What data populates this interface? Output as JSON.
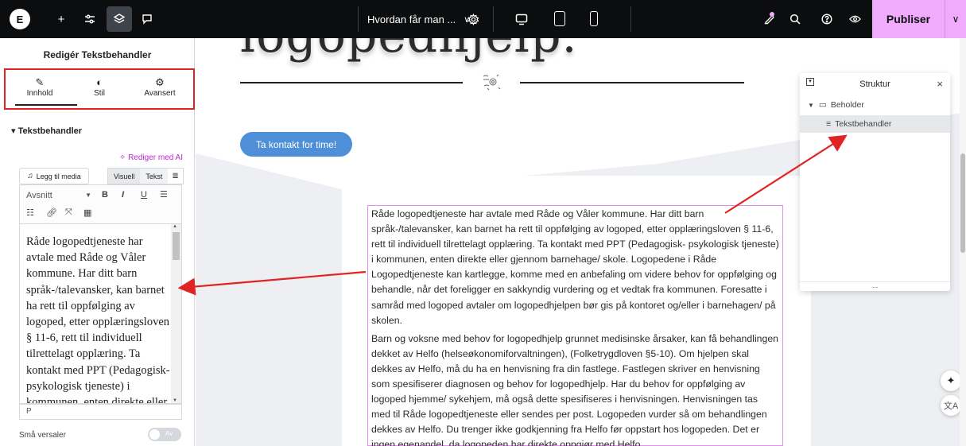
{
  "topbar": {
    "logo": "E",
    "add_icon": "+",
    "settings_icon": "⚙",
    "layers_icon": "◈",
    "comments_icon": "▭",
    "document_title": "Hvordan får man ...",
    "publish_label": "Publiser",
    "accent_color": "#f0abfc"
  },
  "panel": {
    "title": "Redigér Tekstbehandler",
    "tabs": [
      {
        "label": "Innhold",
        "icon": "pencil-icon"
      },
      {
        "label": "Stil",
        "icon": "contrast-icon"
      },
      {
        "label": "Avansert",
        "icon": "gear-icon"
      }
    ],
    "section_heading": "Tekstbehandler",
    "ai_link": "Rediger med AI",
    "add_media": "Legg til media",
    "mode_visual": "Visuell",
    "mode_text": "Tekst",
    "format_select": "Avsnitt",
    "editor_text": "Råde logopedtjeneste har avtale med Råde og Våler kommune. Har ditt barn språk-/talevansker, kan barnet ha rett til oppfølging av logoped, etter opplæringsloven § 11-6, rett til individuell tilrettelagt opplæring. Ta kontakt med PPT (Pedagogisk-psykologisk tjeneste) i kommunen, enten direkte eller",
    "status_path": "P",
    "small_caps_label": "Små versaler",
    "toggle_off": "Av"
  },
  "canvas": {
    "heading": "logopedhjelp.",
    "cta_label": "Ta kontakt for time!",
    "paragraph1": "Råde logopedtjeneste har avtale med Råde og Våler kommune. Har ditt barn språk-/talevansker, kan barnet ha rett til oppfølging av logoped, etter opplæringsloven § 11-6, rett til individuell tilrettelagt opplæring. Ta kontakt med PPT (Pedagogisk- psykologisk tjeneste) i kommunen, enten direkte eller gjennom barnehage/ skole. Logopedene i Råde Logopedtjeneste kan kartlegge, komme med en anbefaling om videre behov for oppfølging og behandle, når det foreligger en sakkyndig vurdering og et vedtak fra kommunen. Foresatte i samråd med logoped avtaler om logopedhjelpen bør gis på kontoret og/eller i barnehagen/ på skolen.",
    "paragraph2": "Barn og voksne med behov for logopedhjelp grunnet medisinske årsaker, kan få behandlingen dekket av Helfo (helseøkonomiforvaltningen), (Folketrygdloven §5-10). Om hjelpen skal dekkes av Helfo, må du ha en henvisning fra din fastlege. Fastlegen skriver en henvisning som spesifiserer diagnosen og behov for logopedhjelp. Har du behov for oppfølging av logoped hjemme/ sykehjem, må også dette spesifiseres i henvisningen. Henvisningen tas med til Råde logopedtjeneste eller sendes per post. Logopeden vurder så om behandlingen dekkes av Helfo. Du trenger ikke godkjenning fra Helfo før oppstart hos logopeden. Det er ingen egenandel, da logopeden har direkte oppgjør med Helfo."
  },
  "structure": {
    "title": "Struktur",
    "items": [
      {
        "label": "Beholder",
        "icon": "container-icon"
      },
      {
        "label": "Tekstbehandler",
        "icon": "text-editor-icon"
      }
    ],
    "footer": "..."
  }
}
